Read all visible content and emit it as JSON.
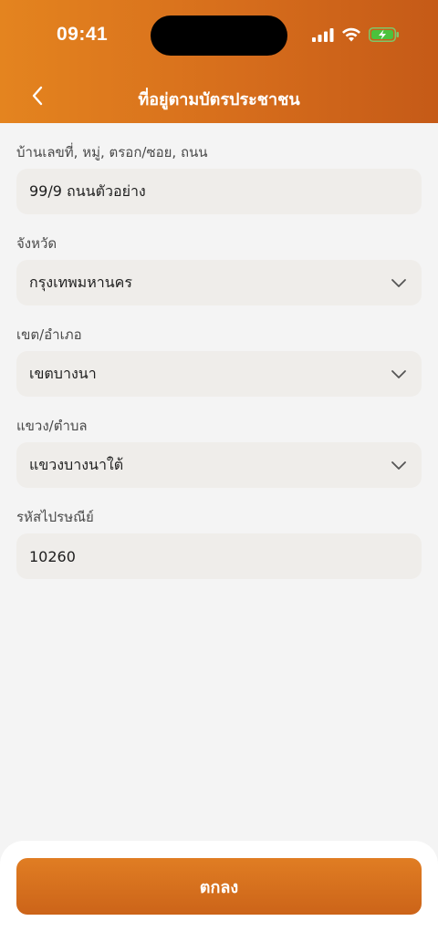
{
  "status_bar": {
    "time": "09:41"
  },
  "header": {
    "title": "ที่อยู่ตามบัตรประชาชน"
  },
  "fields": [
    {
      "label": "บ้านเลขที่, หมู่, ตรอก/ซอย, ถนน",
      "value": "99/9 ถนนตัวอย่าง"
    },
    {
      "label": "จังหวัด",
      "value": "กรุงเทพมหานคร"
    },
    {
      "label": "เขต/อำเภอ",
      "value": "เขตบางนา"
    },
    {
      "label": "แขวง/ตำบล",
      "value": "แขวงบางนาใต้"
    },
    {
      "label": "รหัสไปรษณีย์",
      "value": "10260"
    }
  ],
  "footer": {
    "confirm_label": "ตกลง"
  },
  "colors": {
    "accent": "#d66d1c",
    "field_bg": "#efedea",
    "page_bg": "#f4f4f4"
  },
  "icons": [
    "back-chevron-icon",
    "cellular-signal-icon",
    "wifi-icon",
    "battery-charging-icon",
    "chevron-down-icon"
  ]
}
